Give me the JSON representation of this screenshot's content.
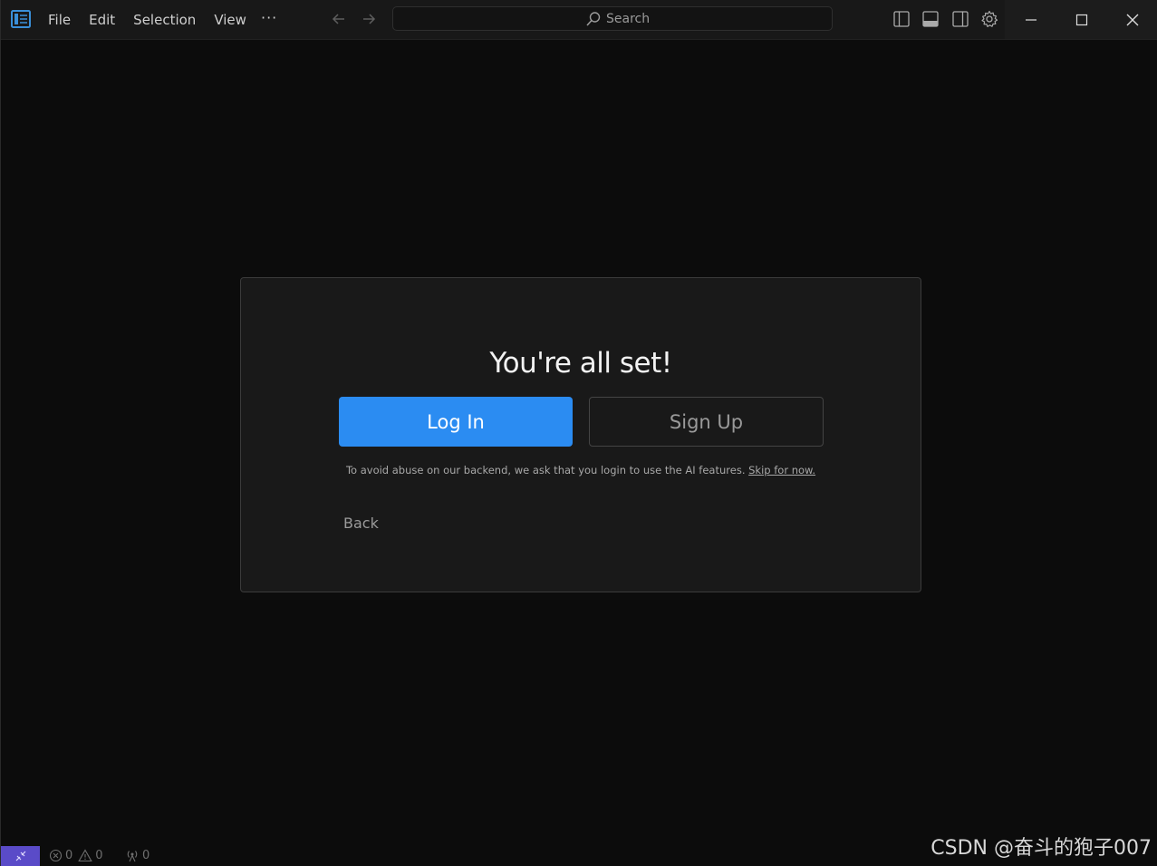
{
  "titlebar": {
    "menu": [
      "File",
      "Edit",
      "Selection",
      "View"
    ],
    "more_label": "···",
    "search_placeholder": "Search"
  },
  "dialog": {
    "title": "You're all set!",
    "login_label": "Log In",
    "signup_label": "Sign Up",
    "notice_text": "To avoid abuse on our backend, we ask that you login to use the AI features.",
    "skip_label": "Skip for now.",
    "back_label": "Back"
  },
  "statusbar": {
    "errors": "0",
    "warnings": "0",
    "ports": "0"
  },
  "watermark": "CSDN @奋斗的狍子007",
  "colors": {
    "accent": "#2b8cf2",
    "remote": "#5a4bc8",
    "background": "#0c0c0c",
    "dialog_bg": "#191919"
  },
  "icons": [
    "app-logo-icon",
    "arrow-left-icon",
    "arrow-right-icon",
    "search-icon",
    "toggle-primary-sidebar-icon",
    "toggle-panel-icon",
    "toggle-secondary-sidebar-icon",
    "gear-icon",
    "minimize-icon",
    "maximize-icon",
    "close-icon",
    "remote-icon",
    "error-icon",
    "warning-icon",
    "ports-icon"
  ]
}
